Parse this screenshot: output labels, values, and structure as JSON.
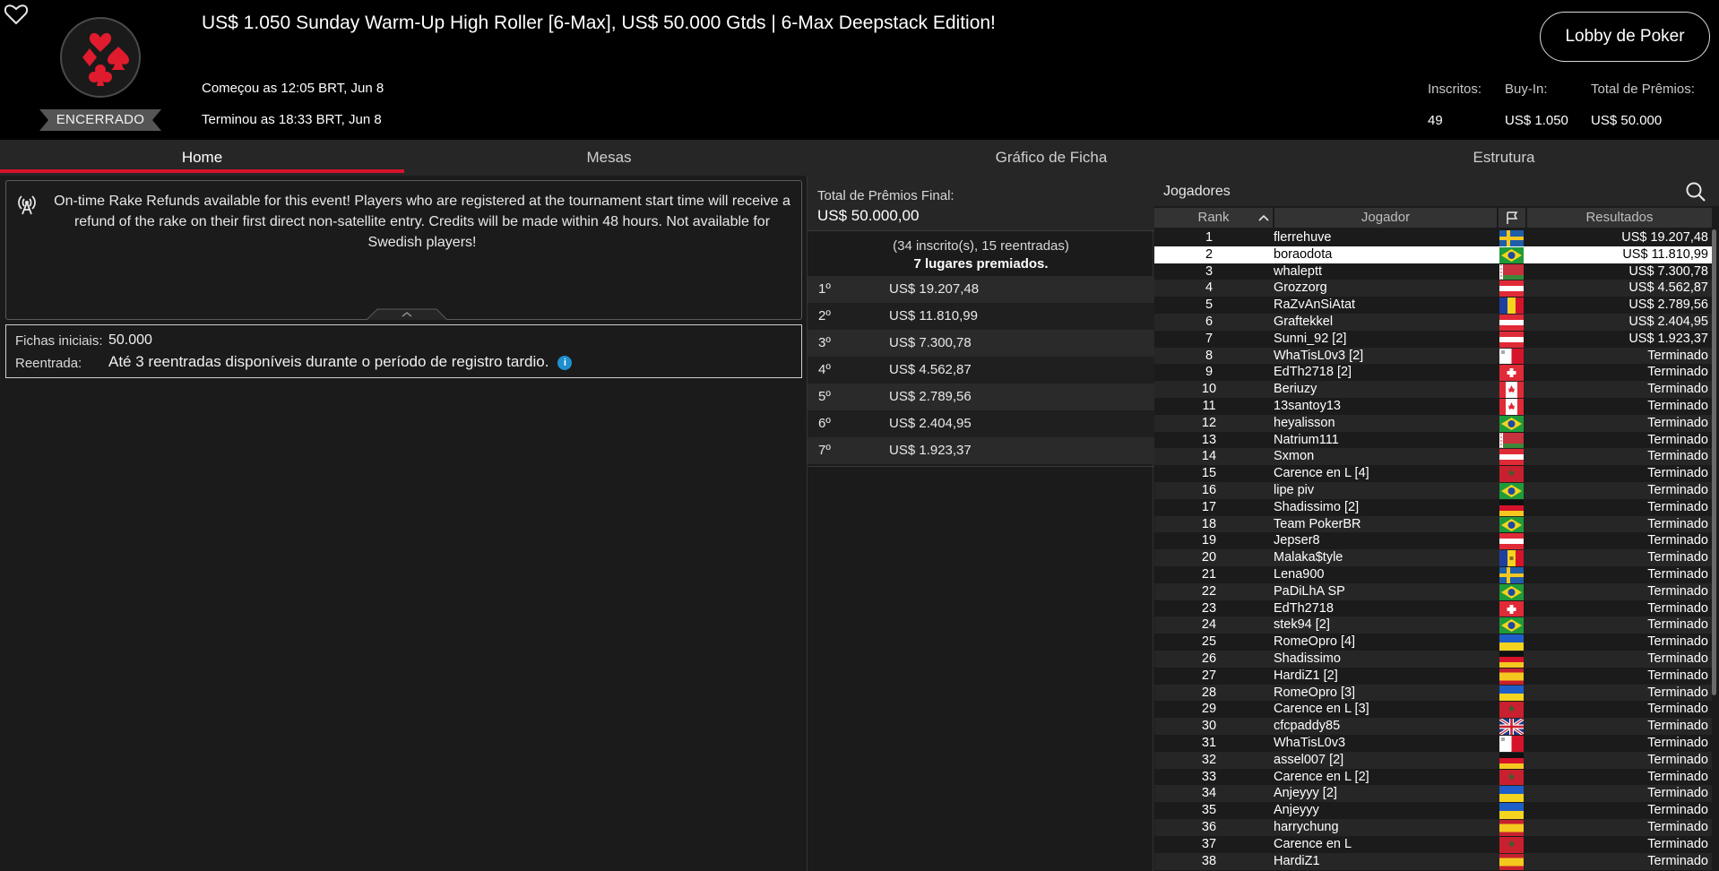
{
  "header": {
    "title": "US$ 1.050 Sunday Warm-Up High Roller [6-Max], US$ 50.000 Gtds | 6-Max Deepstack Edition!",
    "started": "Começou as 12:05 BRT, Jun 8",
    "ended": "Terminou as 18:33 BRT, Jun 8",
    "status": "ENCERRADO",
    "lobby_button": "Lobby de Poker",
    "stats": {
      "registered_label": "Inscritos:",
      "registered_value": "49",
      "buyin_label": "Buy-In:",
      "buyin_value": "US$ 1.050",
      "prize_label": "Total de Prêmios:",
      "prize_value": "US$ 50.000"
    }
  },
  "tabs": [
    "Home",
    "Mesas",
    "Gráfico de Ficha",
    "Estrutura"
  ],
  "notice": "On-time Rake Refunds available for this event! Players who are registered at the tournament start time will receive a refund of the rake on their first direct non-satellite entry. Credits will be made within 48 hours. Not available for Swedish players!",
  "info": {
    "chips_label": "Fichas iniciais:",
    "chips_value": "50.000",
    "reentry_label": "Reentrada:",
    "reentry_value": "Até 3 reentradas disponíveis durante o período de registro tardio.",
    "info_glyph": "i"
  },
  "prizes": {
    "total_label": "Total de Prêmios Final:",
    "total_value": "US$ 50.000,00",
    "entries_text": "(34 inscrito(s), 15 reentradas)",
    "places_text": "7 lugares premiados.",
    "rows": [
      {
        "place": "1º",
        "amount": "US$ 19.207,48"
      },
      {
        "place": "2º",
        "amount": "US$ 11.810,99"
      },
      {
        "place": "3º",
        "amount": "US$ 7.300,78"
      },
      {
        "place": "4º",
        "amount": "US$ 4.562,87"
      },
      {
        "place": "5º",
        "amount": "US$ 2.789,56"
      },
      {
        "place": "6º",
        "amount": "US$ 2.404,95"
      },
      {
        "place": "7º",
        "amount": "US$ 1.923,37"
      }
    ]
  },
  "players": {
    "title": "Jogadores",
    "columns": {
      "rank": "Rank",
      "player": "Jogador",
      "result": "Resultados"
    },
    "rows": [
      {
        "rank": "1",
        "name": "flerrehuve",
        "flag": "se",
        "result": "US$ 19.207,48"
      },
      {
        "rank": "2",
        "name": "boraodota",
        "flag": "br",
        "result": "US$ 11.810,99"
      },
      {
        "rank": "3",
        "name": "whaleptt",
        "flag": "by",
        "result": "US$ 7.300,78"
      },
      {
        "rank": "4",
        "name": "Grozzorg",
        "flag": "at",
        "result": "US$ 4.562,87"
      },
      {
        "rank": "5",
        "name": "RaZvAnSiAtat",
        "flag": "ro",
        "result": "US$ 2.789,56"
      },
      {
        "rank": "6",
        "name": "Graftekkel",
        "flag": "at",
        "result": "US$ 2.404,95"
      },
      {
        "rank": "7",
        "name": "Sunni_92 [2]",
        "flag": "at",
        "result": "US$ 1.923,37"
      },
      {
        "rank": "8",
        "name": "WhaTisL0v3 [2]",
        "flag": "mt",
        "result": "Terminado"
      },
      {
        "rank": "9",
        "name": "EdTh2718 [2]",
        "flag": "ch",
        "result": "Terminado"
      },
      {
        "rank": "10",
        "name": "Beriuzy",
        "flag": "ca",
        "result": "Terminado"
      },
      {
        "rank": "11",
        "name": "13santoy13",
        "flag": "ca",
        "result": "Terminado"
      },
      {
        "rank": "12",
        "name": "heyalisson",
        "flag": "br",
        "result": "Terminado"
      },
      {
        "rank": "13",
        "name": "Natrium111",
        "flag": "by",
        "result": "Terminado"
      },
      {
        "rank": "14",
        "name": "Sxmon",
        "flag": "at",
        "result": "Terminado"
      },
      {
        "rank": "15",
        "name": "Carence en L [4]",
        "flag": "ma",
        "result": "Terminado"
      },
      {
        "rank": "16",
        "name": "lipe piv",
        "flag": "br",
        "result": "Terminado"
      },
      {
        "rank": "17",
        "name": "Shadissimo [2]",
        "flag": "de",
        "result": "Terminado"
      },
      {
        "rank": "18",
        "name": "Team PokerBR",
        "flag": "br",
        "result": "Terminado"
      },
      {
        "rank": "19",
        "name": "Jepser8",
        "flag": "at",
        "result": "Terminado"
      },
      {
        "rank": "20",
        "name": "Malaka$tyle",
        "flag": "md",
        "result": "Terminado"
      },
      {
        "rank": "21",
        "name": "Lena900",
        "flag": "se",
        "result": "Terminado"
      },
      {
        "rank": "22",
        "name": "PaDiLhA SP",
        "flag": "br",
        "result": "Terminado"
      },
      {
        "rank": "23",
        "name": "EdTh2718",
        "flag": "ch",
        "result": "Terminado"
      },
      {
        "rank": "24",
        "name": "stek94 [2]",
        "flag": "br",
        "result": "Terminado"
      },
      {
        "rank": "25",
        "name": "RomeOpro [4]",
        "flag": "ua",
        "result": "Terminado"
      },
      {
        "rank": "26",
        "name": "Shadissimo",
        "flag": "de",
        "result": "Terminado"
      },
      {
        "rank": "27",
        "name": "HardiZ1 [2]",
        "flag": "es",
        "result": "Terminado"
      },
      {
        "rank": "28",
        "name": "RomeOpro [3]",
        "flag": "ua",
        "result": "Terminado"
      },
      {
        "rank": "29",
        "name": "Carence en L [3]",
        "flag": "ma",
        "result": "Terminado"
      },
      {
        "rank": "30",
        "name": "cfcpaddy85",
        "flag": "gb",
        "result": "Terminado"
      },
      {
        "rank": "31",
        "name": "WhaTisL0v3",
        "flag": "mt",
        "result": "Terminado"
      },
      {
        "rank": "32",
        "name": "assel007 [2]",
        "flag": "de",
        "result": "Terminado"
      },
      {
        "rank": "33",
        "name": "Carence en L [2]",
        "flag": "ma",
        "result": "Terminado"
      },
      {
        "rank": "34",
        "name": "Anjeyyy [2]",
        "flag": "ua",
        "result": "Terminado"
      },
      {
        "rank": "35",
        "name": "Anjeyyy",
        "flag": "ua",
        "result": "Terminado"
      },
      {
        "rank": "36",
        "name": "harrychung",
        "flag": "es",
        "result": "Terminado"
      },
      {
        "rank": "37",
        "name": "Carence en L",
        "flag": "ma",
        "result": "Terminado"
      },
      {
        "rank": "38",
        "name": "HardiZ1",
        "flag": "es",
        "result": "Terminado"
      }
    ],
    "highlight_rank": "2"
  },
  "colors": {
    "accent": "#d6132a",
    "header_bg": "#000000",
    "panel_bg": "#1b1b1b",
    "row_alt": "#262626",
    "info_blue": "#1f8fcf"
  },
  "icons": {
    "favorite": "heart-outline-icon",
    "logo": "poker-suits-logo",
    "notice": "broadcast-antenna-icon",
    "search": "search-icon",
    "flag_column": "flag-icon",
    "sort": "chevron-up-icon"
  }
}
